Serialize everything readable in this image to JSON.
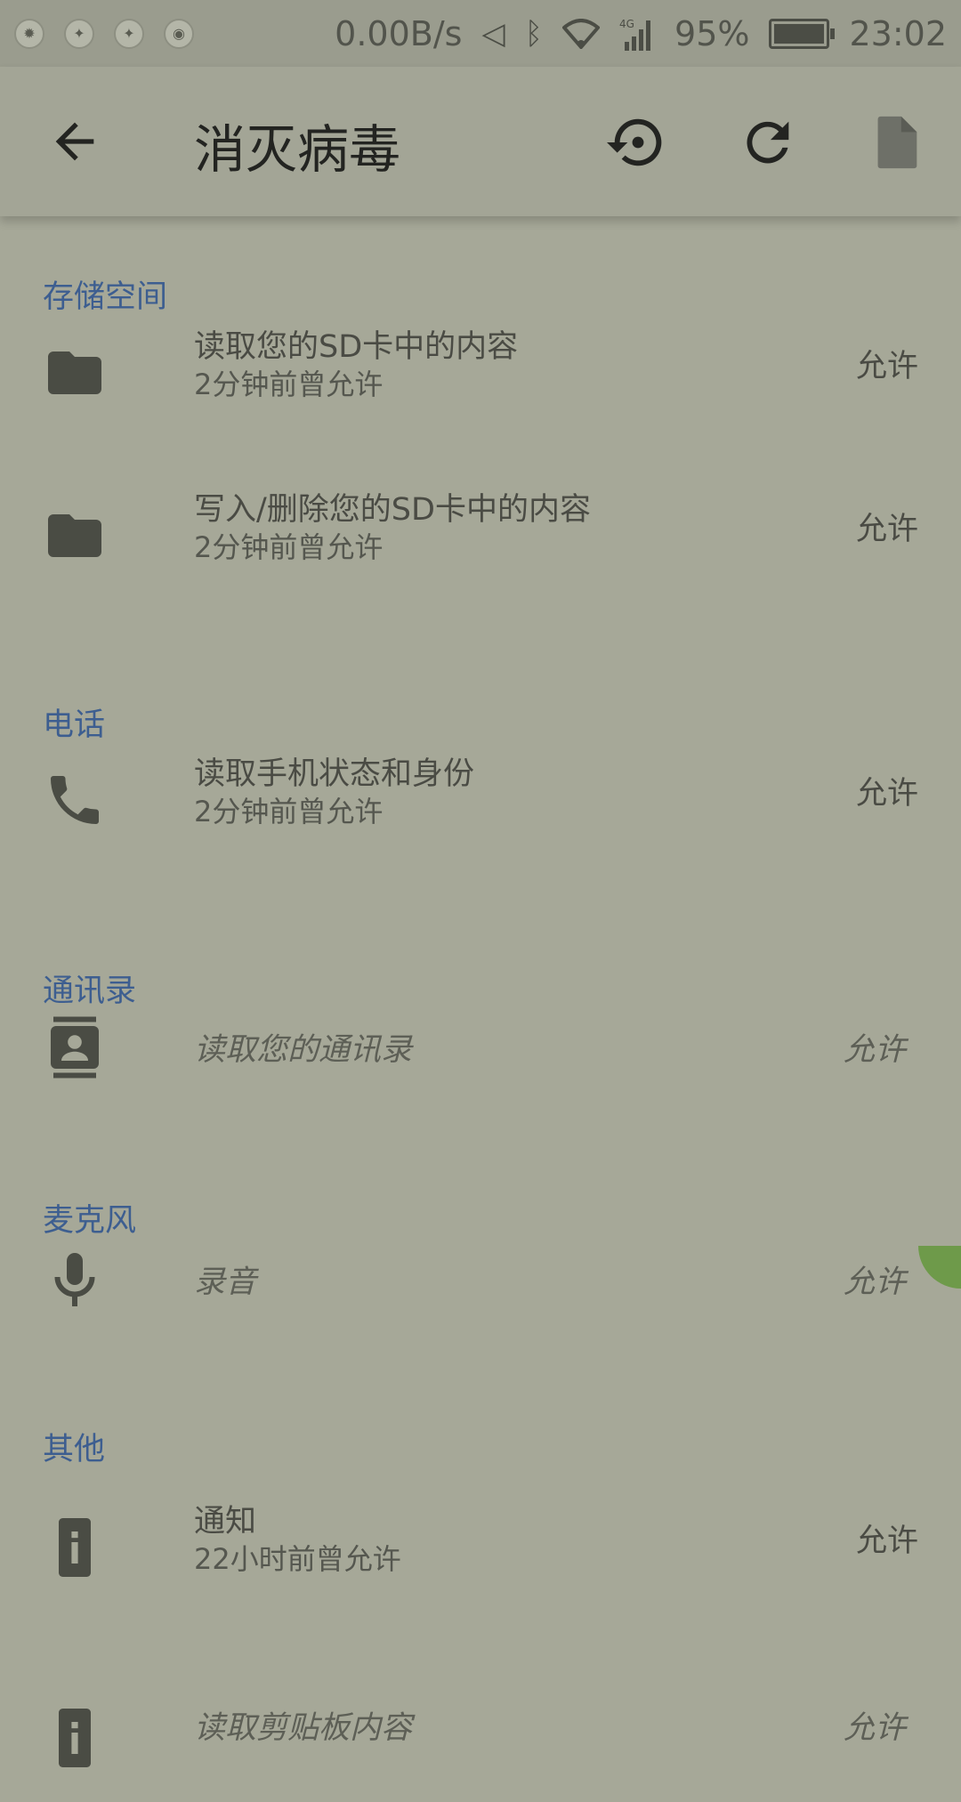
{
  "status_bar": {
    "net_speed": "0.00B/s",
    "battery_percent": "95%",
    "time": "23:02",
    "icons": [
      "settings-icon",
      "dna-app-icon",
      "dna-app-icon",
      "eye-icon",
      "mute-icon",
      "bluetooth-icon",
      "wifi-icon",
      "signal-4g-icon",
      "battery-icon"
    ]
  },
  "app_bar": {
    "title": "消灭病毒",
    "actions": [
      "restore-icon",
      "refresh-icon",
      "document-icon"
    ]
  },
  "sections": [
    {
      "header": "存储空间",
      "items": [
        {
          "icon": "folder-icon",
          "title": "读取您的SD卡中的内容",
          "subtitle": "2分钟前曾允许",
          "status": "允许"
        },
        {
          "icon": "folder-icon",
          "title": "写入/删除您的SD卡中的内容",
          "subtitle": "2分钟前曾允许",
          "status": "允许"
        }
      ]
    },
    {
      "header": "电话",
      "items": [
        {
          "icon": "phone-icon",
          "title": "读取手机状态和身份",
          "subtitle": "2分钟前曾允许",
          "status": "允许"
        }
      ]
    },
    {
      "header": "通讯录",
      "items": [
        {
          "icon": "contacts-icon",
          "title": "读取您的通讯录",
          "subtitle": "",
          "status": "允许"
        }
      ]
    },
    {
      "header": "麦克风",
      "items": [
        {
          "icon": "microphone-icon",
          "title": "录音",
          "subtitle": "",
          "status": "允许"
        }
      ]
    },
    {
      "header": "其他",
      "items": [
        {
          "icon": "info-device-icon",
          "title": "通知",
          "subtitle": "22小时前曾允许",
          "status": "允许"
        },
        {
          "icon": "info-device-icon",
          "title": "读取剪贴板内容",
          "subtitle": "",
          "status": "允许"
        }
      ]
    }
  ]
}
